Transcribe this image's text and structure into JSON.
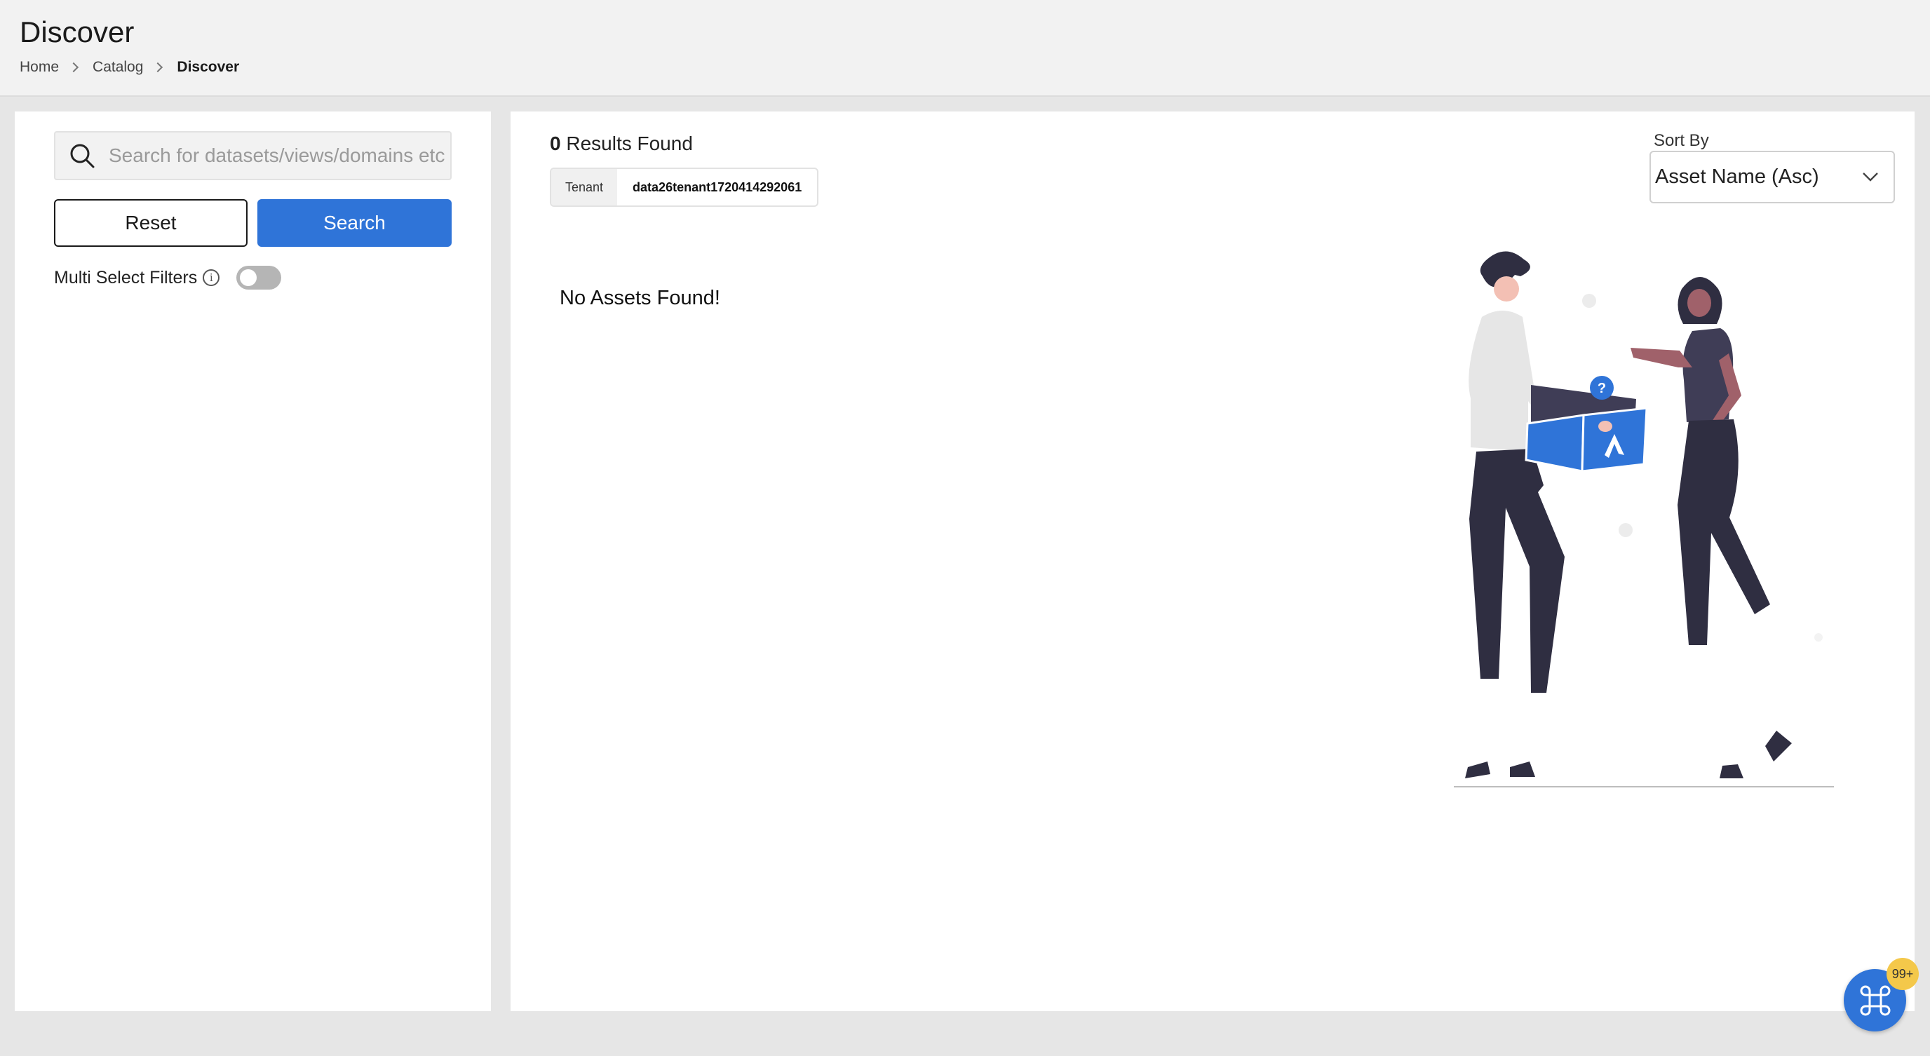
{
  "header": {
    "title": "Discover",
    "breadcrumb": [
      {
        "label": "Home"
      },
      {
        "label": "Catalog"
      },
      {
        "label": "Discover"
      }
    ]
  },
  "filters": {
    "search_placeholder": "Search for datasets/views/domains etc.",
    "search_value": "",
    "reset_label": "Reset",
    "search_label": "Search",
    "multi_select_label": "Multi Select Filters",
    "multi_select_enabled": false
  },
  "results": {
    "count": "0",
    "count_suffix": "Results Found",
    "tenant_label": "Tenant",
    "tenant_value": "data26tenant1720414292061",
    "empty_message": "No Assets Found!"
  },
  "sort": {
    "label": "Sort By",
    "selected": "Asset Name (Asc)"
  },
  "command_button": {
    "badge": "99+"
  },
  "colors": {
    "accent": "#2f74d8",
    "badge": "#f4c84a",
    "header_bg": "#f2f2f2",
    "page_bg": "#e6e6e6"
  },
  "icons": [
    "search-icon",
    "chevron-right-icon",
    "info-icon",
    "chevron-down-icon",
    "command-icon"
  ]
}
